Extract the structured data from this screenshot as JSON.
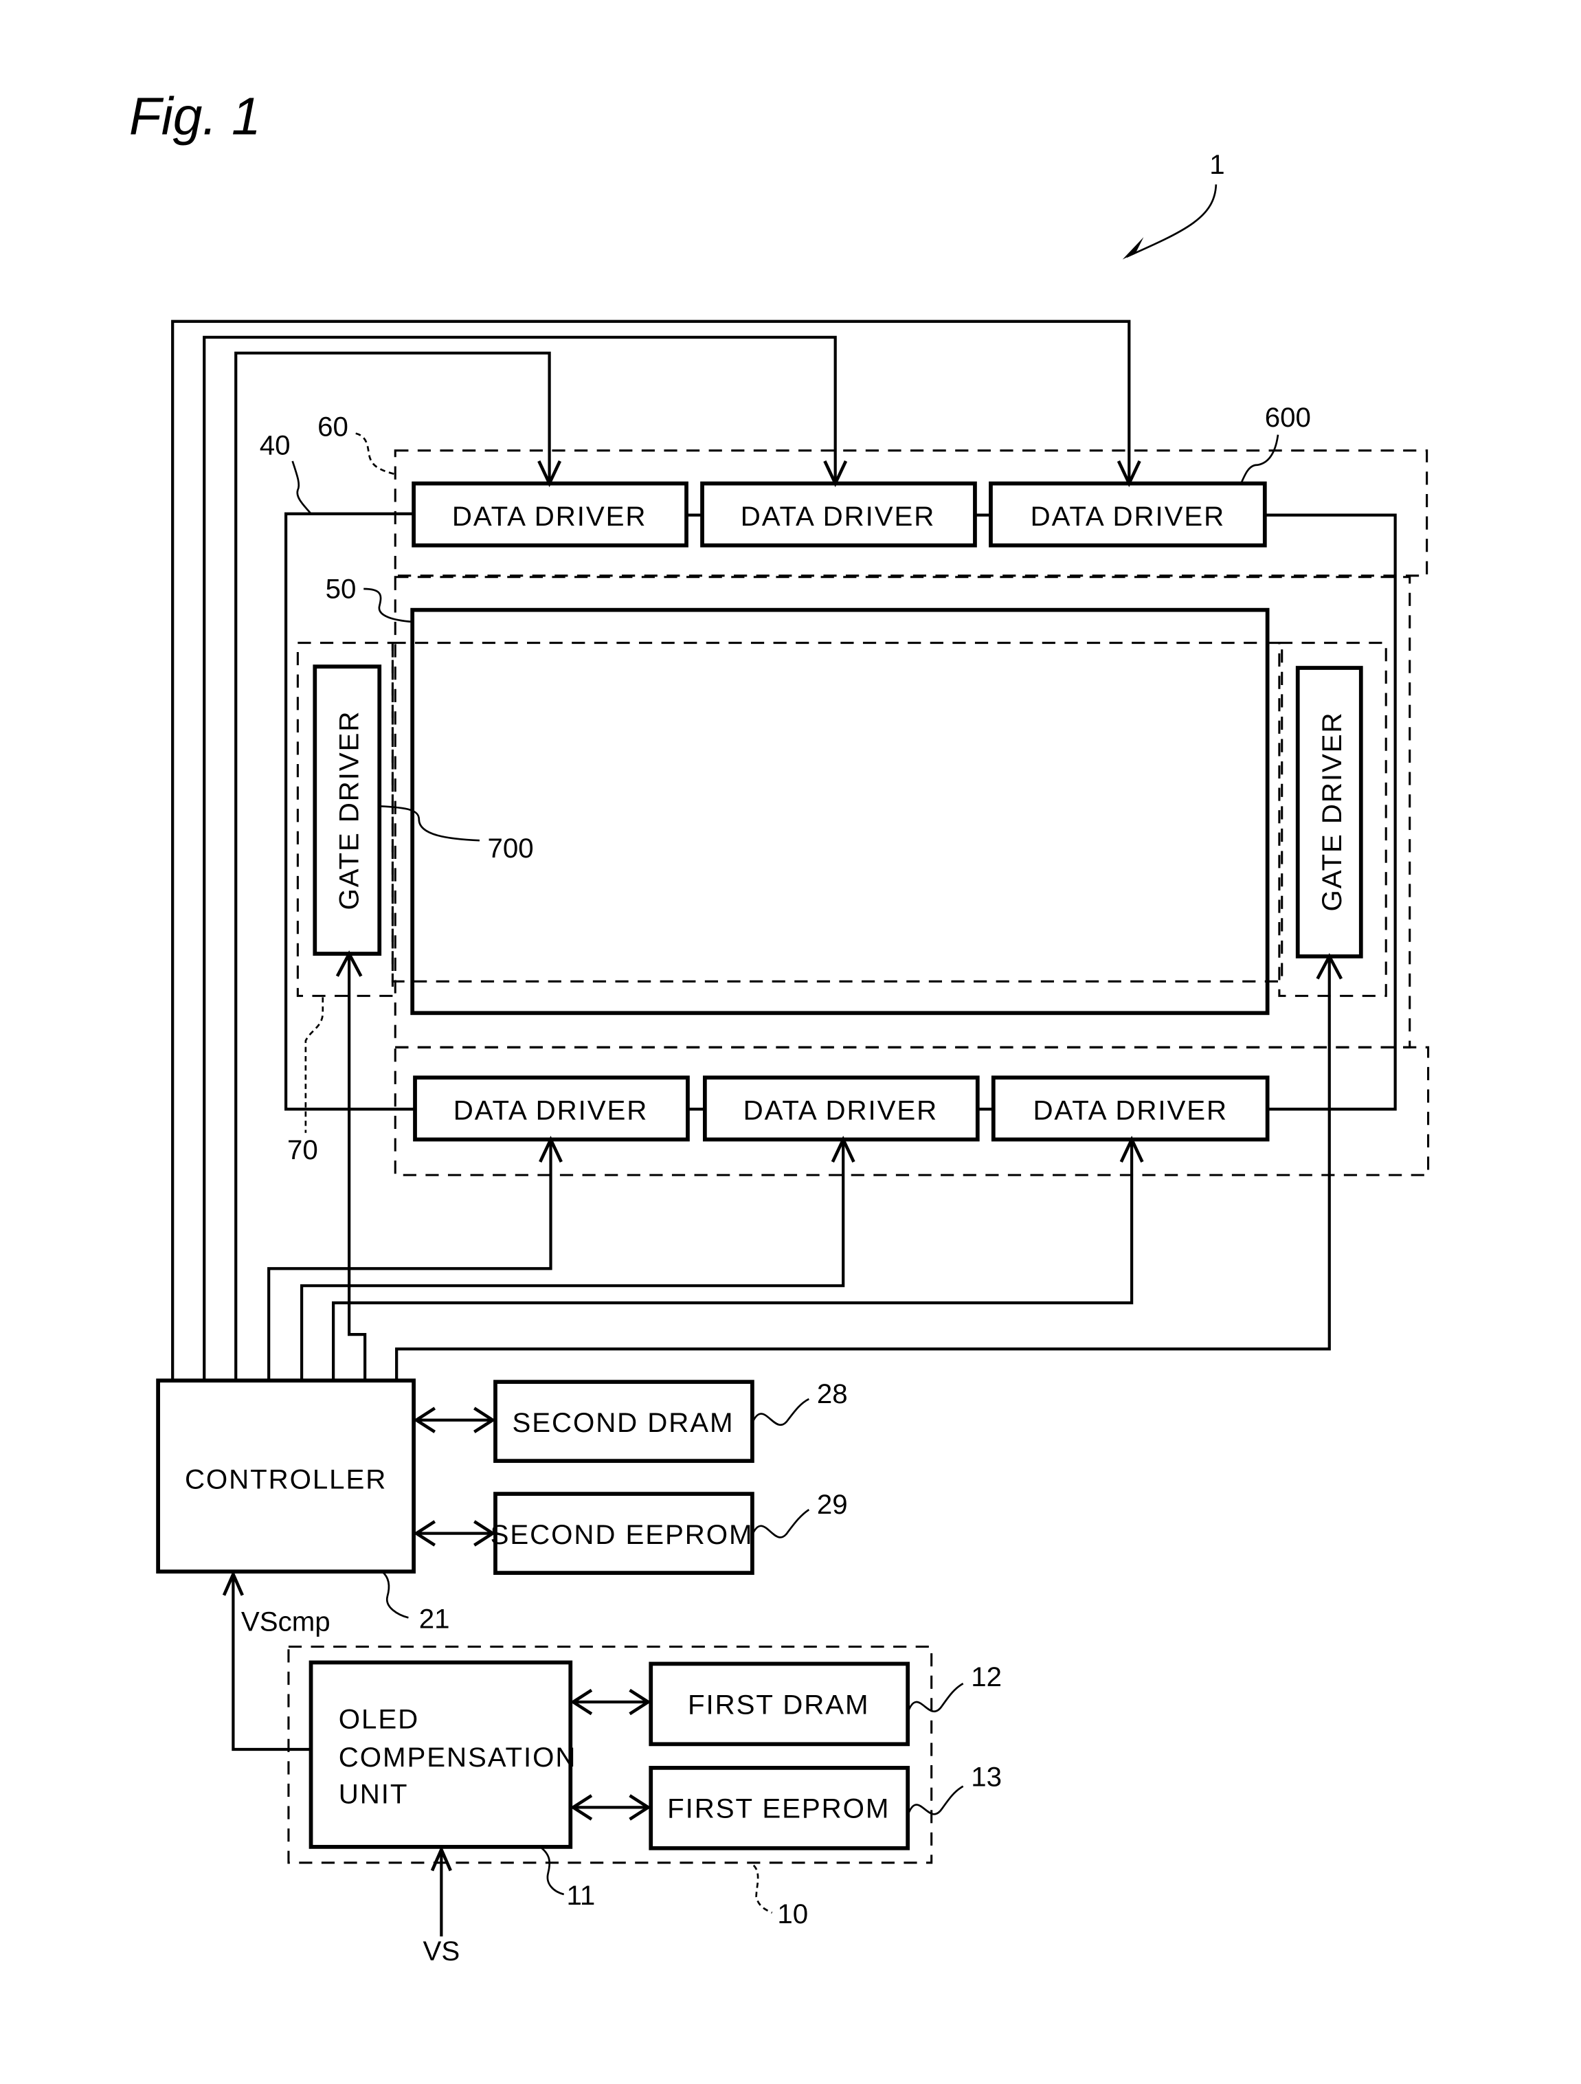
{
  "figure": {
    "title": "Fig. 1",
    "system_ref": "1"
  },
  "blocks": {
    "data_driver_label": "DATA DRIVER",
    "gate_driver_label": "GATE DRIVER",
    "controller": "CONTROLLER",
    "second_dram": "SECOND DRAM",
    "second_eeprom": "SECOND EEPROM",
    "oled_comp_line1": "OLED",
    "oled_comp_line2": "COMPENSATION",
    "oled_comp_line3": "UNIT",
    "first_dram": "FIRST DRAM",
    "first_eeprom": "FIRST EEPROM"
  },
  "signals": {
    "vscmp": "VScmp",
    "vs": "VS"
  },
  "refs": {
    "r40": "40",
    "r60": "60",
    "r600": "600",
    "r50": "50",
    "r700": "700",
    "r70": "70",
    "r28": "28",
    "r29": "29",
    "r21": "21",
    "r12": "12",
    "r13": "13",
    "r11": "11",
    "r10": "10"
  }
}
